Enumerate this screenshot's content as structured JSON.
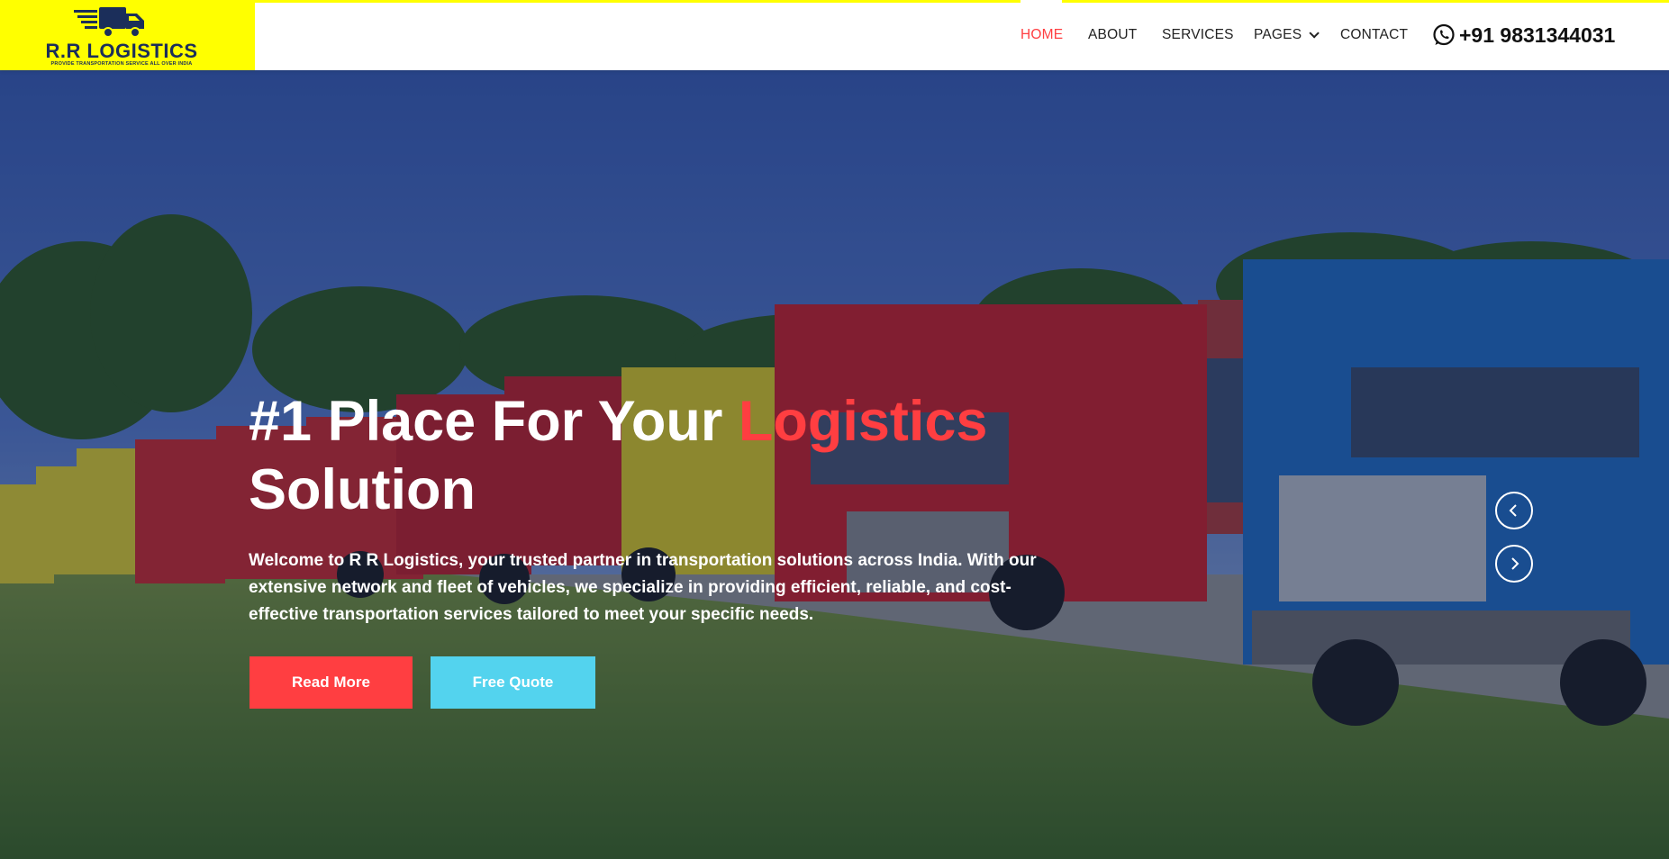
{
  "brand": {
    "name": "R.R LOGISTICS",
    "tagline": "PROVIDE TRANSPORTATION SERVICE ALL OVER INDIA",
    "logo_icon": "delivery-truck-icon",
    "logo_bg": "#ffff00",
    "logo_text_color": "#1b2e5a"
  },
  "nav": {
    "items": [
      {
        "label": "HOME",
        "active": true
      },
      {
        "label": "ABOUT",
        "active": false
      },
      {
        "label": "SERVICES",
        "active": false
      },
      {
        "label": "PAGES",
        "active": false,
        "dropdown": true
      },
      {
        "label": "CONTACT",
        "active": false
      }
    ],
    "phone_icon": "whatsapp-icon",
    "phone": "+91 9831344031",
    "active_color": "#ff3e41"
  },
  "hero": {
    "title_part1": "#1 Place For Your ",
    "title_accent": "Logistics",
    "title_part2": "Solution",
    "description": "Welcome to R R Logistics, your trusted partner in transportation solutions across India. With our extensive network and fleet of vehicles, we specialize in providing efficient, reliable, and cost-effective transportation services tailored to meet your specific needs.",
    "buttons": {
      "read_more": "Read More",
      "free_quote": "Free Quote"
    },
    "carousel": {
      "prev_icon": "chevron-left-icon",
      "next_icon": "chevron-right-icon"
    },
    "colors": {
      "accent": "#ff3e41",
      "secondary": "#53d3ee"
    }
  }
}
